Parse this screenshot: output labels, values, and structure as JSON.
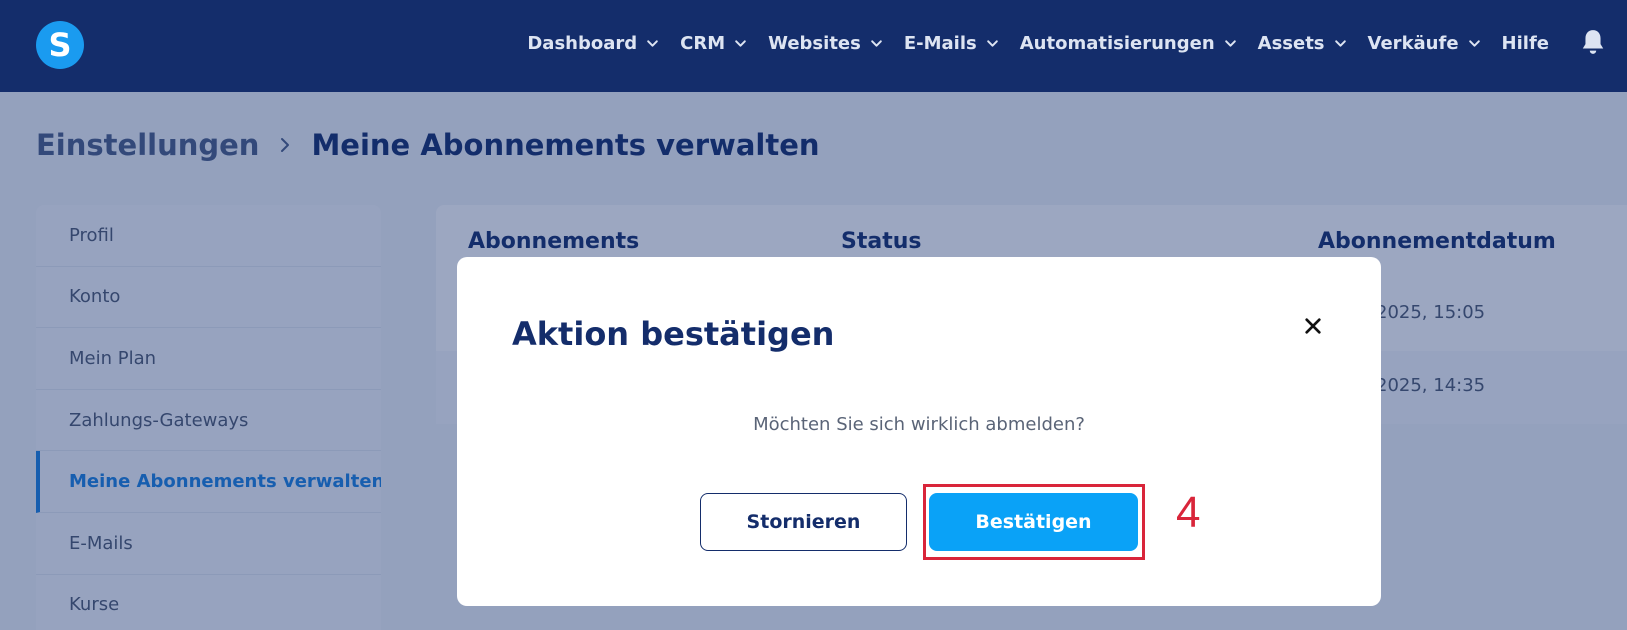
{
  "nav": {
    "logo": "S",
    "items": [
      {
        "label": "Dashboard",
        "dropdown": true
      },
      {
        "label": "CRM",
        "dropdown": true
      },
      {
        "label": "Websites",
        "dropdown": true
      },
      {
        "label": "E-Mails",
        "dropdown": true
      },
      {
        "label": "Automatisierungen",
        "dropdown": true
      },
      {
        "label": "Assets",
        "dropdown": true
      },
      {
        "label": "Verkäufe",
        "dropdown": true
      },
      {
        "label": "Hilfe",
        "dropdown": false
      }
    ],
    "icons": {
      "notifications": "bell-icon",
      "dropdown": "chevron-down-icon"
    }
  },
  "breadcrumb": {
    "root": "Einstellungen",
    "current": "Meine Abonnements verwalten"
  },
  "sidebar": {
    "items": [
      {
        "label": "Profil",
        "active": false
      },
      {
        "label": "Konto",
        "active": false
      },
      {
        "label": "Mein Plan",
        "active": false
      },
      {
        "label": "Zahlungs-Gateways",
        "active": false
      },
      {
        "label": "Meine Abonnements verwalten",
        "active": true
      },
      {
        "label": "E-Mails",
        "active": false
      },
      {
        "label": "Kurse",
        "active": false
      }
    ]
  },
  "table": {
    "headers": {
      "subscriptions": "Abonnements",
      "status": "Status",
      "date": "Abonnementdatum"
    },
    "rows": [
      {
        "date": "2025, 15:05"
      },
      {
        "date": "2025, 14:35"
      }
    ]
  },
  "modal": {
    "title": "Aktion bestätigen",
    "message": "Möchten Sie sich wirklich abmelden?",
    "cancel_label": "Stornieren",
    "confirm_label": "Bestätigen"
  },
  "annotation": {
    "step_number": "4",
    "color": "#d9253a"
  },
  "colors": {
    "navbar": "#142d6b",
    "accent": "#0aa2f7",
    "active_link": "#1a82e0"
  }
}
